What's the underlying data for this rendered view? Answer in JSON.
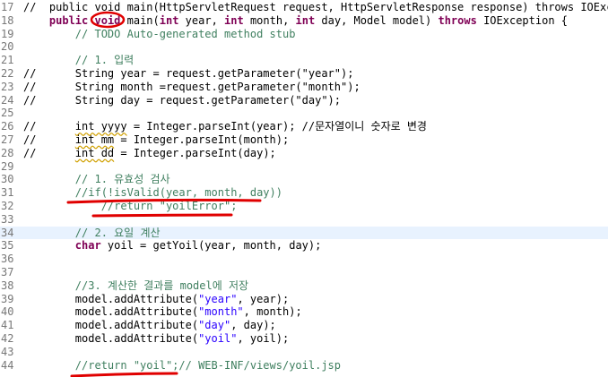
{
  "editor": {
    "lines": [
      {
        "n": "17",
        "current": false,
        "segs": [
          {
            "t": "//  public void main(HttpServletRequest request, HttpServletResponse response) throws IOExcep",
            "c": "t"
          }
        ]
      },
      {
        "n": "18",
        "current": false,
        "segs": [
          {
            "t": "    ",
            "c": "t"
          },
          {
            "t": "public",
            "c": "k"
          },
          {
            "t": " ",
            "c": "t"
          },
          {
            "t": "void",
            "c": "k"
          },
          {
            "t": " main(",
            "c": "t"
          },
          {
            "t": "int",
            "c": "k"
          },
          {
            "t": " year, ",
            "c": "t"
          },
          {
            "t": "int",
            "c": "k"
          },
          {
            "t": " month, ",
            "c": "t"
          },
          {
            "t": "int",
            "c": "k"
          },
          {
            "t": " day, Model model) ",
            "c": "t"
          },
          {
            "t": "throws",
            "c": "k"
          },
          {
            "t": " IOException {",
            "c": "t"
          }
        ]
      },
      {
        "n": "19",
        "current": false,
        "segs": [
          {
            "t": "        // TODO Auto-generated method stub",
            "c": "c"
          }
        ]
      },
      {
        "n": "20",
        "current": false,
        "segs": []
      },
      {
        "n": "21",
        "current": false,
        "segs": [
          {
            "t": "        // 1. 입력",
            "c": "c"
          }
        ]
      },
      {
        "n": "22",
        "current": false,
        "segs": [
          {
            "t": "//      String year = request.getParameter(\"year\");",
            "c": "t"
          }
        ]
      },
      {
        "n": "23",
        "current": false,
        "segs": [
          {
            "t": "//      String month =request.getParameter(\"month\");",
            "c": "t"
          }
        ]
      },
      {
        "n": "24",
        "current": false,
        "segs": [
          {
            "t": "//      String day = request.getParameter(\"day\");",
            "c": "t"
          }
        ]
      },
      {
        "n": "25",
        "current": false,
        "segs": []
      },
      {
        "n": "26",
        "current": false,
        "segs": [
          {
            "t": "//      ",
            "c": "t"
          },
          {
            "t": "int yyyy",
            "c": "t",
            "u": true
          },
          {
            "t": " = Integer.parseInt(year); //문자열이니 숫자로 변경",
            "c": "t"
          }
        ]
      },
      {
        "n": "27",
        "current": false,
        "segs": [
          {
            "t": "//      ",
            "c": "t"
          },
          {
            "t": "int mm",
            "c": "t",
            "u": true
          },
          {
            "t": " = Integer.parseInt(month);",
            "c": "t"
          }
        ]
      },
      {
        "n": "28",
        "current": false,
        "segs": [
          {
            "t": "//      ",
            "c": "t"
          },
          {
            "t": "int dd",
            "c": "t",
            "u": true
          },
          {
            "t": " = Integer.parseInt(day);",
            "c": "t"
          }
        ]
      },
      {
        "n": "29",
        "current": false,
        "segs": []
      },
      {
        "n": "30",
        "current": false,
        "segs": [
          {
            "t": "        // 1. 유효성 검사",
            "c": "c"
          }
        ]
      },
      {
        "n": "31",
        "current": false,
        "segs": [
          {
            "t": "        //if(!isValid(year, month, day))",
            "c": "c"
          }
        ]
      },
      {
        "n": "32",
        "current": false,
        "segs": [
          {
            "t": "            //return \"yoilError\";",
            "c": "c"
          }
        ]
      },
      {
        "n": "33",
        "current": false,
        "segs": []
      },
      {
        "n": "34",
        "current": true,
        "segs": [
          {
            "t": "        // 2. 요일 계산",
            "c": "c"
          }
        ]
      },
      {
        "n": "35",
        "current": false,
        "segs": [
          {
            "t": "        ",
            "c": "t"
          },
          {
            "t": "char",
            "c": "k"
          },
          {
            "t": " yoil = getYoil(year, month, day);",
            "c": "t"
          }
        ]
      },
      {
        "n": "36",
        "current": false,
        "segs": []
      },
      {
        "n": "37",
        "current": false,
        "segs": []
      },
      {
        "n": "38",
        "current": false,
        "segs": [
          {
            "t": "        //3. 계산한 결과를 model에 저장",
            "c": "c"
          }
        ]
      },
      {
        "n": "39",
        "current": false,
        "segs": [
          {
            "t": "        model.addAttribute(",
            "c": "t"
          },
          {
            "t": "\"year\"",
            "c": "s"
          },
          {
            "t": ", year);",
            "c": "t"
          }
        ]
      },
      {
        "n": "40",
        "current": false,
        "segs": [
          {
            "t": "        model.addAttribute(",
            "c": "t"
          },
          {
            "t": "\"month\"",
            "c": "s"
          },
          {
            "t": ", month);",
            "c": "t"
          }
        ]
      },
      {
        "n": "41",
        "current": false,
        "segs": [
          {
            "t": "        model.addAttribute(",
            "c": "t"
          },
          {
            "t": "\"day\"",
            "c": "s"
          },
          {
            "t": ", day);",
            "c": "t"
          }
        ]
      },
      {
        "n": "42",
        "current": false,
        "segs": [
          {
            "t": "        model.addAttribute(",
            "c": "t"
          },
          {
            "t": "\"yoil\"",
            "c": "s"
          },
          {
            "t": ", yoil);",
            "c": "t"
          }
        ]
      },
      {
        "n": "43",
        "current": false,
        "segs": []
      },
      {
        "n": "44",
        "current": false,
        "segs": [
          {
            "t": "        //return \"yoil\";// WEB-INF/views/yoil.jsp",
            "c": "c"
          }
        ]
      }
    ]
  },
  "colors": {
    "keyword": "#7f0055",
    "comment": "#3f7f5f",
    "string": "#2a00ff",
    "annotation_red": "#e00000",
    "current_line": "#e8f2fe"
  }
}
